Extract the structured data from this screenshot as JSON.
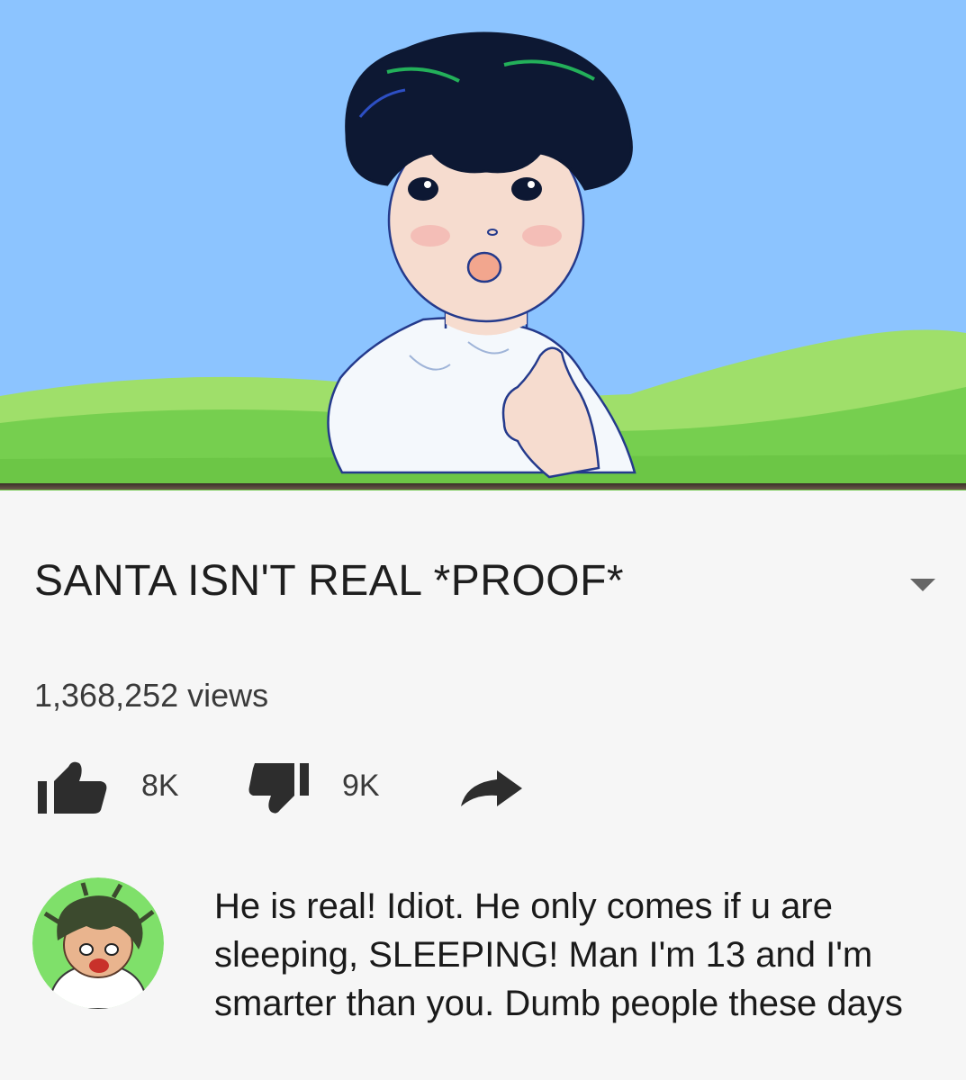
{
  "video": {
    "title": "SANTA ISN'T REAL *PROOF*",
    "views": "1,368,252 views"
  },
  "actions": {
    "like_count": "8K",
    "dislike_count": "9K"
  },
  "icons": {
    "like": "thumbs-up-icon",
    "dislike": "thumbs-down-icon",
    "share": "share-arrow-icon",
    "expand": "chevron-down-icon"
  },
  "comment": {
    "text": "He is real! Idiot. He only comes if u are sleeping, SLEEPING! Man I'm 13 and I'm smarter than you. Dumb people these days"
  },
  "colors": {
    "sky": "#8cc4ff",
    "grass": "#7fd35a",
    "page_background": "#f6f6f6",
    "avatar_ring": "#7fe06a"
  }
}
